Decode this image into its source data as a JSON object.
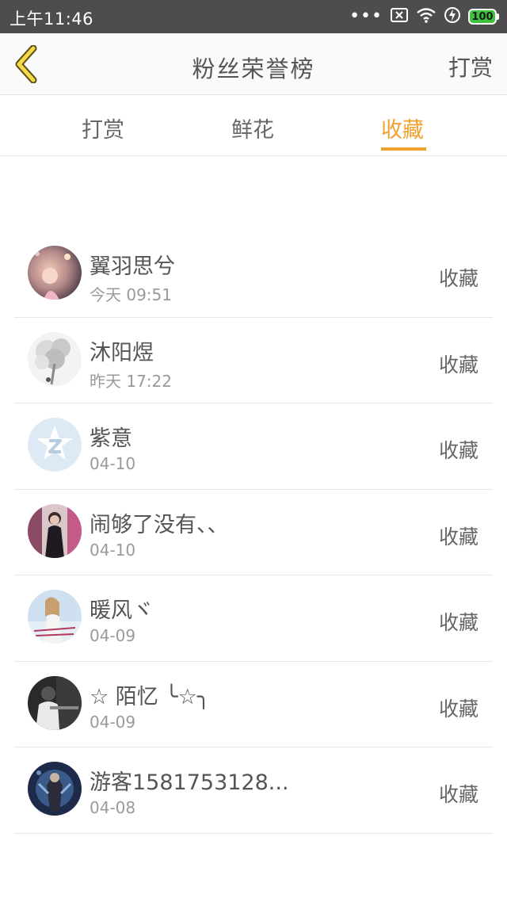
{
  "status_bar": {
    "time": "上午11:46",
    "battery": "100",
    "colors": {
      "background": "#4d4d4d",
      "battery": "#3ec23e"
    }
  },
  "header": {
    "title": "粉丝荣誉榜",
    "action": "打赏",
    "accent": "#f0a22e"
  },
  "tabs": [
    {
      "label": "打赏",
      "active": false
    },
    {
      "label": "鲜花",
      "active": false
    },
    {
      "label": "收藏",
      "active": true
    }
  ],
  "list": [
    {
      "name": "翼羽思兮",
      "time": "今天 09:51",
      "type": "收藏",
      "avatar": "photo"
    },
    {
      "name": "沐阳煜",
      "time": "昨天 17:22",
      "type": "收藏",
      "avatar": "photo"
    },
    {
      "name": "紫意",
      "time": "04-10",
      "type": "收藏",
      "avatar": "default-star"
    },
    {
      "name": "闹够了没有、、",
      "time": "04-10",
      "type": "收藏",
      "avatar": "photo"
    },
    {
      "name": "暖风ヾ",
      "time": "04-09",
      "type": "收藏",
      "avatar": "photo"
    },
    {
      "name": "☆ 陌忆 ╰☆╮",
      "time": "04-09",
      "type": "收藏",
      "avatar": "photo"
    },
    {
      "name": "游客1581753128...",
      "time": "04-08",
      "type": "收藏",
      "avatar": "photo"
    }
  ]
}
